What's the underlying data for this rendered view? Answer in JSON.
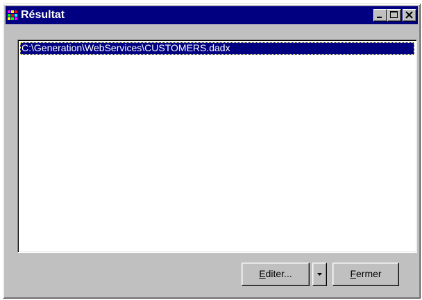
{
  "window": {
    "title": "Résultat",
    "icon": "app-grid-icon"
  },
  "titlebar_buttons": {
    "minimize_icon": "minimize-icon",
    "maximize_icon": "maximize-icon",
    "close_icon": "close-icon"
  },
  "results": {
    "items": [
      {
        "label": "C:\\Generation\\WebServices\\CUSTOMERS.dadx",
        "selected": true
      }
    ]
  },
  "buttons": {
    "edit": {
      "mnemonic": "E",
      "rest": "diter..."
    },
    "edit_dropdown_icon": "chevron-down-icon",
    "close": {
      "mnemonic": "F",
      "rest": "ermer"
    }
  },
  "colors": {
    "titlebar": "#000080",
    "face": "#c0c0c0",
    "selection": "#000080"
  }
}
